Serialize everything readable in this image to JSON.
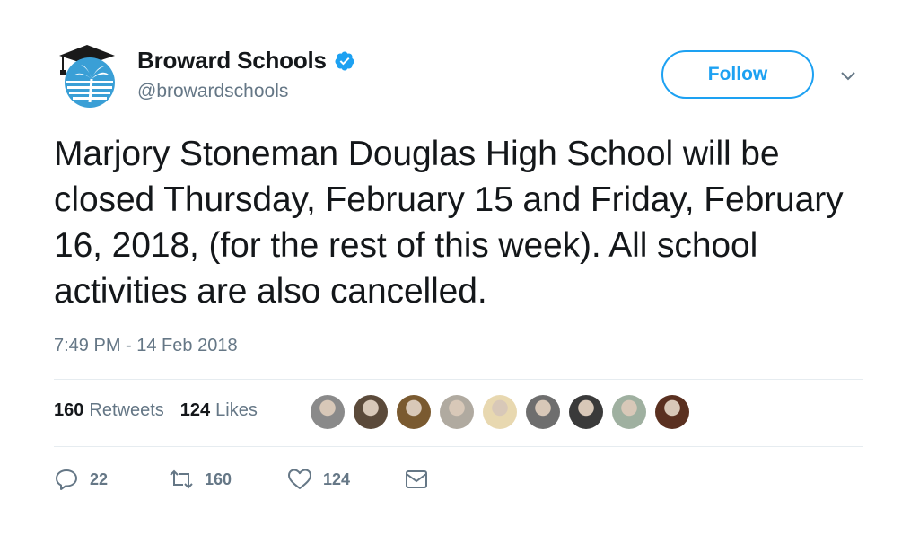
{
  "account": {
    "display_name": "Broward Schools",
    "handle": "@browardschools",
    "verified": true,
    "follow_label": "Follow"
  },
  "tweet": {
    "text": "Marjory Stoneman Douglas High School will be closed Thursday, February 15 and Friday, February 16, 2018, (for the rest of this week). All school activities are also cancelled.",
    "timestamp": "7:49 PM - 14 Feb 2018"
  },
  "stats": {
    "retweets_count": "160",
    "retweets_label": "Retweets",
    "likes_count": "124",
    "likes_label": "Likes"
  },
  "liker_avatars": [
    {
      "name": "liker-avatar-1",
      "color": "#8a8a8a"
    },
    {
      "name": "liker-avatar-2",
      "color": "#5b4a3a"
    },
    {
      "name": "liker-avatar-3",
      "color": "#7a5a30"
    },
    {
      "name": "liker-avatar-4",
      "color": "#b0aaa0"
    },
    {
      "name": "liker-avatar-5",
      "color": "#e8d8b0"
    },
    {
      "name": "liker-avatar-6",
      "color": "#6e6e6e"
    },
    {
      "name": "liker-avatar-7",
      "color": "#3a3a3a"
    },
    {
      "name": "liker-avatar-8",
      "color": "#9fb0a0"
    },
    {
      "name": "liker-avatar-9",
      "color": "#5a3020"
    }
  ],
  "actions": {
    "reply_count": "22",
    "retweet_count": "160",
    "like_count": "124"
  },
  "colors": {
    "accent": "#1da1f2",
    "text_primary": "#14171a",
    "text_secondary": "#657786",
    "divider": "#e6ecf0"
  }
}
